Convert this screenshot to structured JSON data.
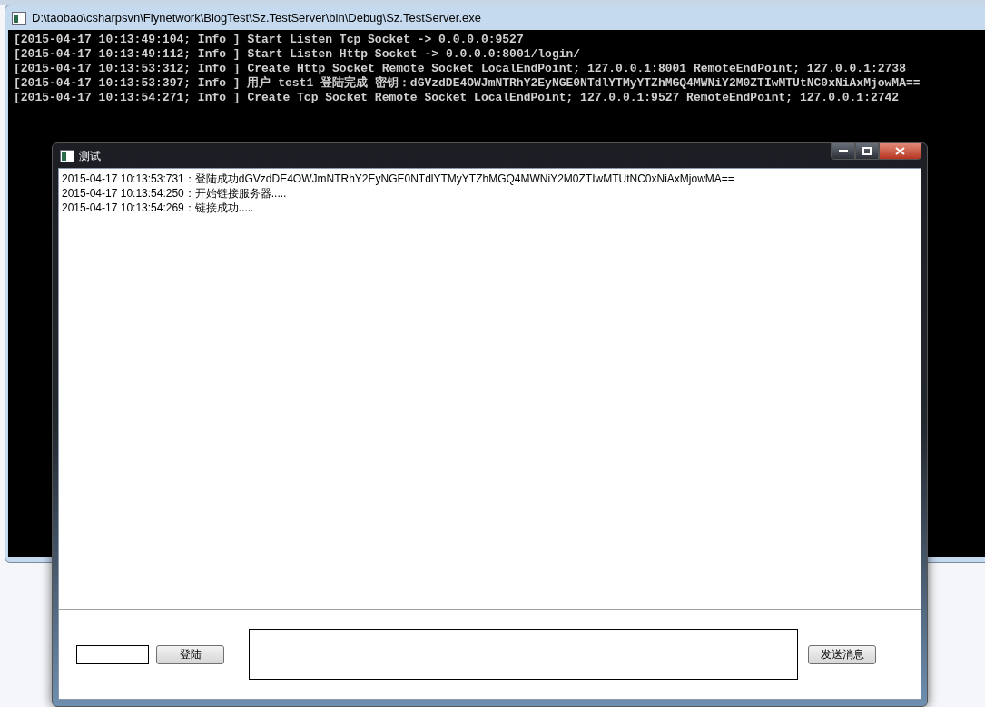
{
  "console_window": {
    "title": "D:\\taobao\\csharpsvn\\Flynetwork\\BlogTest\\Sz.TestServer\\bin\\Debug\\Sz.TestServer.exe",
    "lines": [
      "[2015-04-17 10:13:49:104; Info ] Start Listen Tcp Socket -> 0.0.0.0:9527",
      "[2015-04-17 10:13:49:112; Info ] Start Listen Http Socket -> 0.0.0.0:8001/login/",
      "[2015-04-17 10:13:53:312; Info ] Create Http Socket Remote Socket LocalEndPoint; 127.0.0.1:8001 RemoteEndPoint; 127.0.0.1:2738",
      "[2015-04-17 10:13:53:397; Info ] 用户 test1 登陆完成 密钥：dGVzdDE4OWJmNTRhY2EyNGE0NTdlYTMyYTZhMGQ4MWNiY2M0ZTIwMTUtNC0xNiAxMjowMA==",
      "[2015-04-17 10:13:54:271; Info ] Create Tcp Socket Remote Socket LocalEndPoint; 127.0.0.1:9527 RemoteEndPoint; 127.0.0.1:2742"
    ]
  },
  "dialog": {
    "title": "测试",
    "log": [
      "2015-04-17 10:13:53:731：登陆成功dGVzdDE4OWJmNTRhY2EyNGE0NTdlYTMyYTZhMGQ4MWNiY2M0ZTIwMTUtNC0xNiAxMjowMA==",
      "2015-04-17 10:13:54:250：开始链接服务器.....",
      "2015-04-17 10:13:54:269：链接成功....."
    ],
    "login_button": "登陆",
    "send_button": "发送消息"
  }
}
